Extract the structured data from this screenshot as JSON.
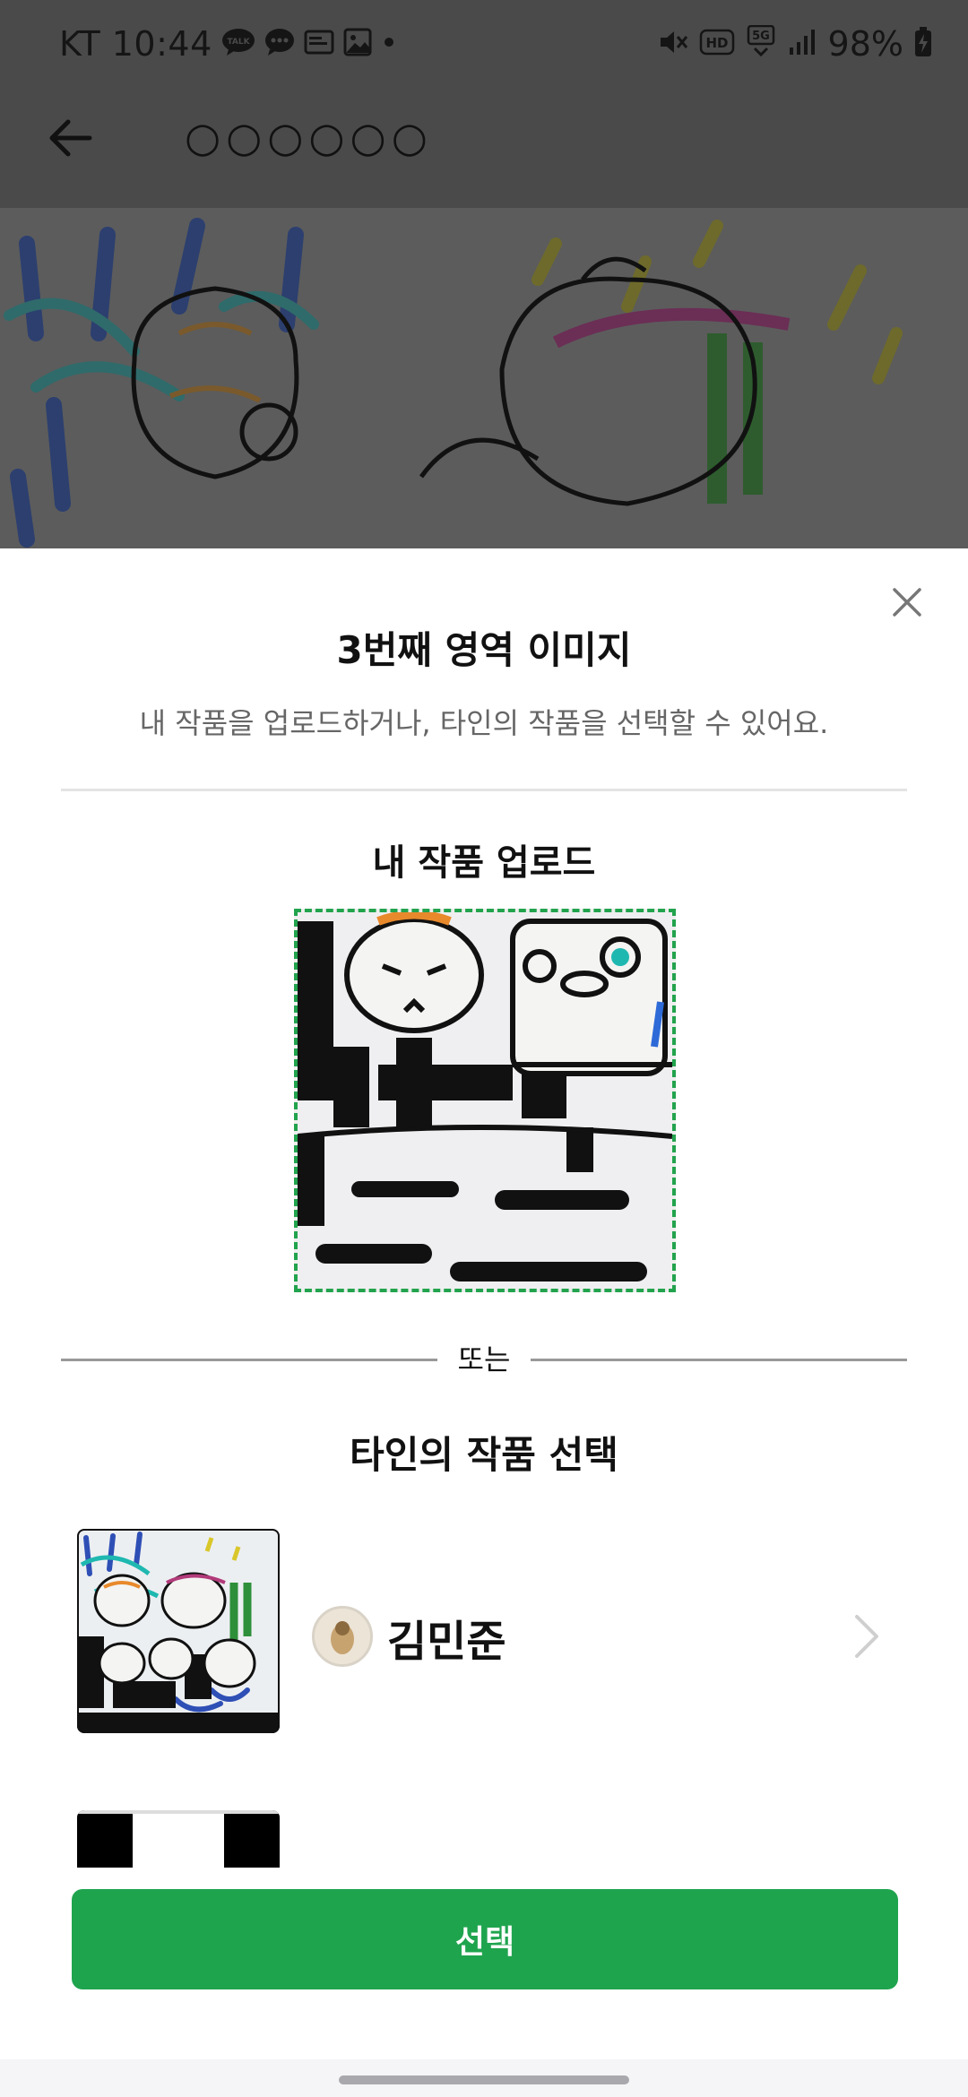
{
  "status_bar": {
    "carrier_time": "KT 10:44",
    "hd_label": "HD",
    "network_label": "5G",
    "battery": "98%"
  },
  "app_bar": {
    "title": "○○○○○○"
  },
  "sheet": {
    "title": "3번째 영역 이미지",
    "subtitle": "내 작품을 업로드하거나, 타인의 작품을 선택할 수 있어요.",
    "upload_title": "내 작품 업로드",
    "or_label": "또는",
    "others_title": "타인의 작품 선택",
    "works": [
      {
        "author": "김민준"
      }
    ],
    "select_button": "선택"
  },
  "colors": {
    "accent_green": "#1fa44e",
    "dashed_border": "#22a34d",
    "dim_overlay": "#4a4a4a"
  },
  "icons": [
    "back-arrow-icon",
    "close-icon",
    "chevron-right-icon",
    "kakaotalk-icon",
    "chat-icon",
    "cast-icon",
    "gallery-icon",
    "mute-icon",
    "signal-icon",
    "battery-charging-icon"
  ]
}
